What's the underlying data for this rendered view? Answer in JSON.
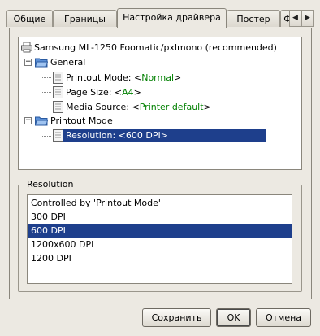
{
  "tabs": [
    {
      "label": "Общие"
    },
    {
      "label": "Границы"
    },
    {
      "label": "Настройка драйвера",
      "active": true
    },
    {
      "label": "Постер"
    },
    {
      "label": "Ф"
    }
  ],
  "tab_scroll": {
    "left": "◀",
    "right": "▶"
  },
  "tree": {
    "root": "Samsung ML-1250 Foomatic/pxlmono (recommended)",
    "general": {
      "label": "General",
      "items": [
        {
          "label": "Printout Mode: <",
          "value": "Normal",
          "close": ">"
        },
        {
          "label": "Page Size: <",
          "value": "A4",
          "close": ">"
        },
        {
          "label": "Media Source: <",
          "value": "Printer default",
          "close": ">"
        }
      ]
    },
    "printout_mode": {
      "label": "Printout Mode",
      "items": [
        {
          "label": "Resolution: <600 DPI>"
        }
      ]
    }
  },
  "resolution": {
    "group_label": "Resolution",
    "options": [
      "Controlled by 'Printout Mode'",
      "300 DPI",
      "600 DPI",
      "1200x600 DPI",
      "1200 DPI"
    ],
    "selected_index": 2
  },
  "buttons": {
    "save": "Сохранить",
    "ok": "OK",
    "cancel": "Отмена"
  },
  "colors": {
    "selection": "#1e3f8c",
    "value_text": "#008000",
    "window_bg": "#ece9e2"
  }
}
